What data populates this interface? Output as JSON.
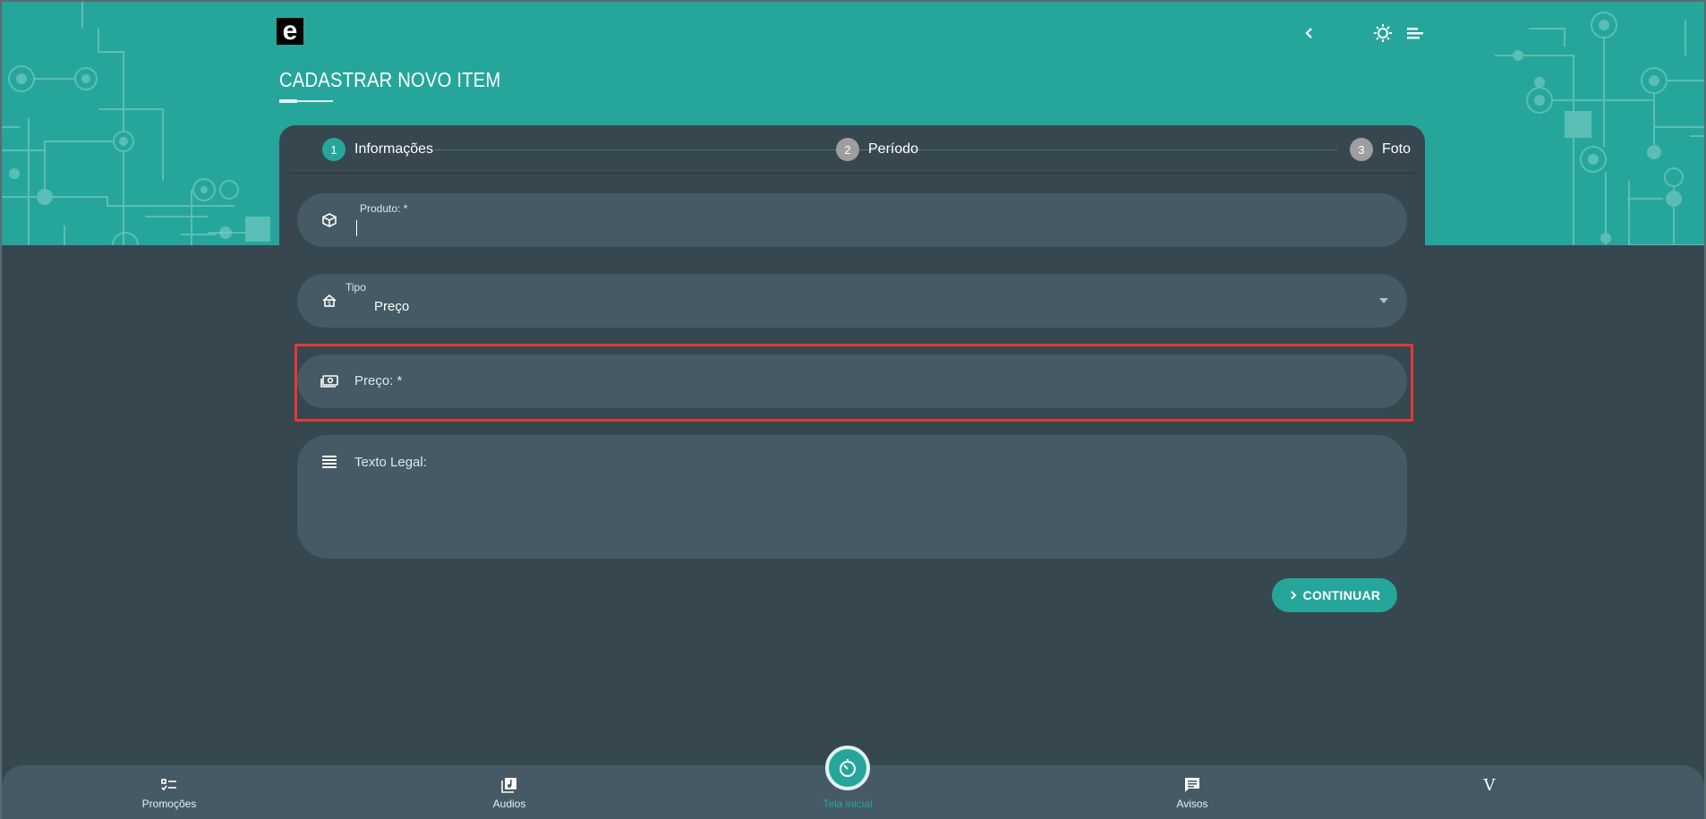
{
  "header": {
    "logo_letter": "e",
    "page_title": "CADASTRAR NOVO ITEM",
    "icons": [
      "chevron-left-icon",
      "brightness-icon",
      "menu-icon"
    ]
  },
  "stepper": {
    "steps": [
      {
        "number": "1",
        "label": "Informações",
        "active": true
      },
      {
        "number": "2",
        "label": "Período",
        "active": false
      },
      {
        "number": "3",
        "label": "Foto",
        "active": false
      }
    ]
  },
  "form": {
    "produto": {
      "label": "Produto: *",
      "value": "",
      "icon": "package-icon"
    },
    "tipo": {
      "label": "Tipo",
      "value": "Preço",
      "icon": "home-tag-icon"
    },
    "preco": {
      "label": "Preço: *",
      "value": "",
      "icon": "cash-icon"
    },
    "texto_legal": {
      "label": "Texto Legal:",
      "value": "",
      "icon": "text-lines-icon"
    }
  },
  "actions": {
    "continue_label": "CONTINUAR"
  },
  "bottom_nav": {
    "items": [
      {
        "label": "Promoções",
        "icon": "checklist-icon"
      },
      {
        "label": "Audios",
        "icon": "music-library-icon"
      },
      {
        "label": "Tela inicial",
        "icon": "timer-icon",
        "active": true
      },
      {
        "label": "Avisos",
        "icon": "message-icon"
      },
      {
        "label": "",
        "icon": "brand-v-icon",
        "glyph": "V"
      }
    ]
  },
  "colors": {
    "accent": "#26a69a",
    "background": "#37474f",
    "field": "#455a64",
    "highlight": "#e53935"
  }
}
